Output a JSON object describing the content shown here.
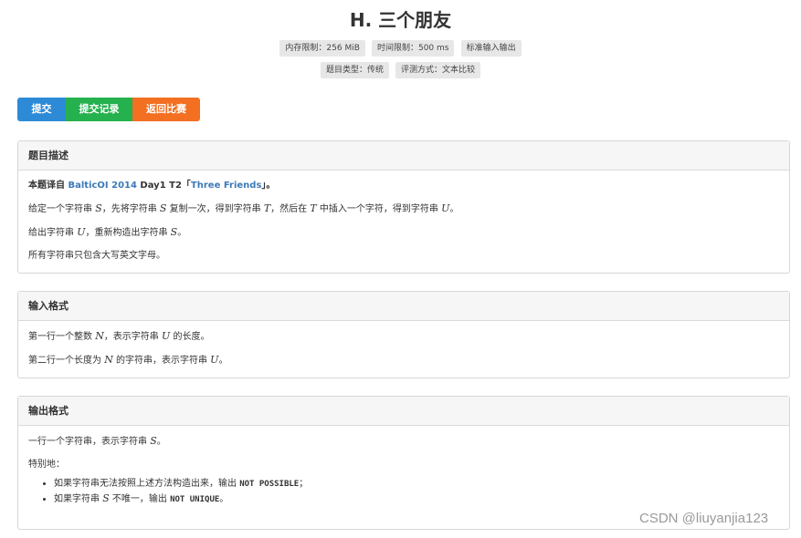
{
  "title": "H. 三个朋友",
  "badges_row1": [
    "内存限制：256 MiB",
    "时间限制：500 ms",
    "标准输入输出"
  ],
  "badges_row2": [
    "题目类型：传统",
    "评测方式：文本比较"
  ],
  "buttons": {
    "submit": "提交",
    "records": "提交记录",
    "back": "返回比赛"
  },
  "description": {
    "heading": "题目描述",
    "intro_prefix": "本题译自 ",
    "intro_link1": "BalticOI 2014",
    "intro_mid": " Day1 T2「",
    "intro_link2": "Three Friends",
    "intro_suffix": "」。",
    "p2_a": "给定一个字符串 ",
    "var_S": "S",
    "p2_b": "，先将字符串 ",
    "p2_c": " 复制一次，得到字符串 ",
    "var_T": "T",
    "p2_d": "，然后在 ",
    "p2_e": " 中插入一个字符，得到字符串 ",
    "var_U": "U",
    "period": "。",
    "p3_a": "给出字符串 ",
    "p3_b": "，重新构造出字符串 ",
    "p4": "所有字符串只包含大写英文字母。"
  },
  "input_format": {
    "heading": "输入格式",
    "l1_a": "第一行一个整数 ",
    "var_N": "N",
    "l1_b": "，表示字符串 ",
    "l1_c": " 的长度。",
    "l2_a": "第二行一个长度为 ",
    "l2_b": " 的字符串，表示字符串 "
  },
  "output_format": {
    "heading": "输出格式",
    "l1_a": "一行一个字符串，表示字符串 ",
    "special": "特别地：",
    "b1_a": "如果字符串无法按照上述方法构造出来，输出 ",
    "b1_code": "NOT POSSIBLE",
    "b1_b": "；",
    "b2_a": "如果字符串 ",
    "b2_b": " 不唯一，输出 ",
    "b2_code": "NOT UNIQUE",
    "b2_c": "。"
  },
  "watermark": "CSDN @liuyanjia123"
}
